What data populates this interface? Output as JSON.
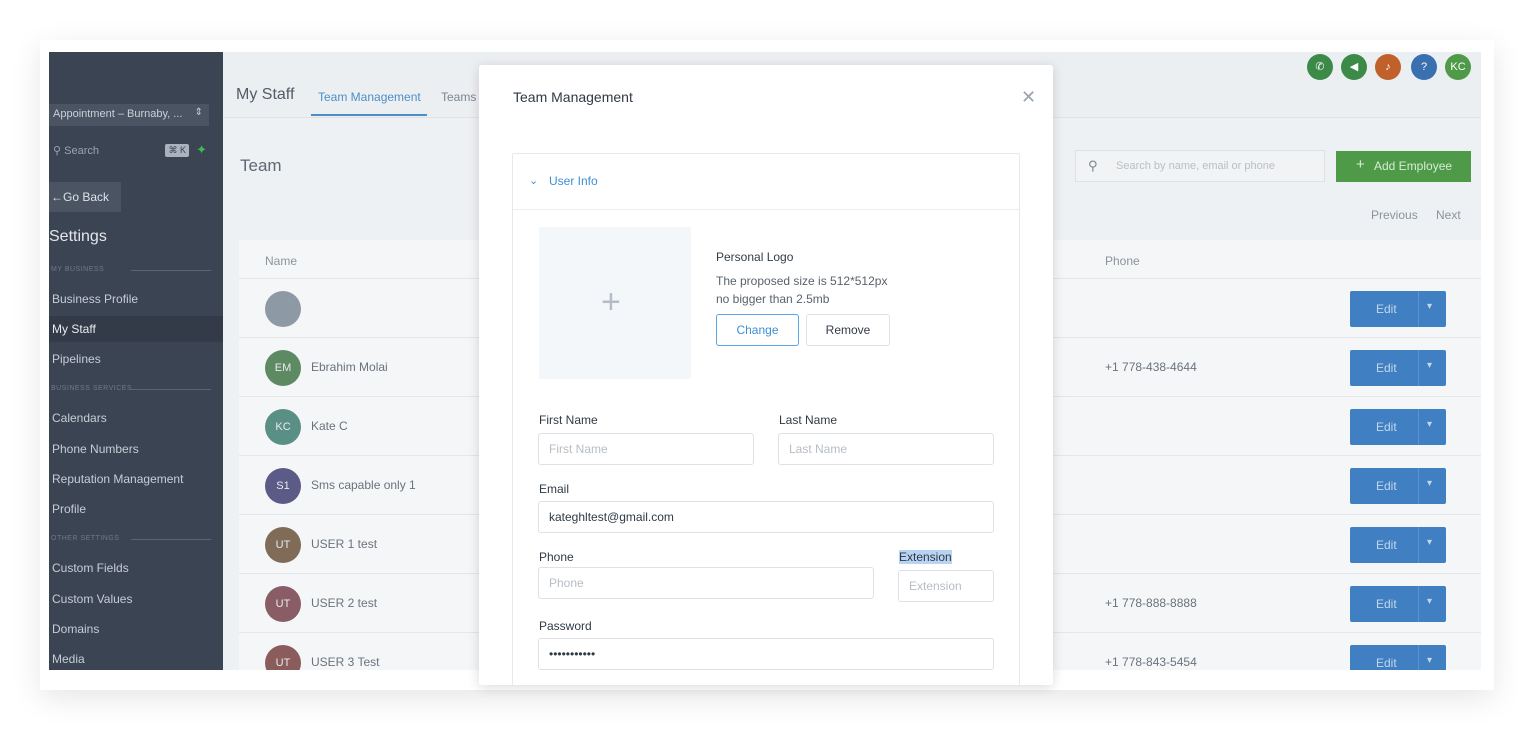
{
  "sidebar": {
    "location_select": "Appointment – Burnaby, ...",
    "search_placeholder": "Search",
    "search_shortcut": "⌘ K",
    "go_back": "Go Back",
    "settings_title": "Settings",
    "sections": [
      "MY BUSINESS",
      "BUSINESS SERVICES",
      "OTHER SETTINGS"
    ],
    "items": [
      {
        "label": "Business Profile",
        "active": false
      },
      {
        "label": "My Staff",
        "active": true
      },
      {
        "label": "Pipelines",
        "active": false
      },
      {
        "label": "Calendars",
        "active": false
      },
      {
        "label": "Phone Numbers",
        "active": false
      },
      {
        "label": "Reputation Management",
        "active": false
      },
      {
        "label": "Profile",
        "active": false
      },
      {
        "label": "Custom Fields",
        "active": false
      },
      {
        "label": "Custom Values",
        "active": false
      },
      {
        "label": "Domains",
        "active": false
      },
      {
        "label": "Media",
        "active": false
      }
    ]
  },
  "topbar": {
    "title": "My Staff",
    "tabs": [
      "Team Management",
      "Teams"
    ],
    "active_tab": "Team Management",
    "user_initials": "KC"
  },
  "main": {
    "title": "Team",
    "search_placeholder": "Search by name, email or phone",
    "add_button": "Add Employee",
    "pager": {
      "previous": "Previous",
      "next": "Next"
    },
    "columns": {
      "name": "Name",
      "phone": "Phone"
    },
    "rows": [
      {
        "initials": "",
        "name": "",
        "phone": "",
        "action": "Edit"
      },
      {
        "initials": "EM",
        "name": "Ebrahim Molai",
        "phone": "+1 778-438-4644",
        "action": "Edit"
      },
      {
        "initials": "KC",
        "name": "Kate C",
        "phone": "",
        "action": "Edit"
      },
      {
        "initials": "S1",
        "name": "Sms capable only 1",
        "phone": "",
        "action": "Edit"
      },
      {
        "initials": "UT",
        "name": "USER 1 test",
        "phone": "",
        "action": "Edit"
      },
      {
        "initials": "UT",
        "name": "USER 2 test",
        "phone": "+1 778-888-8888",
        "action": "Edit"
      },
      {
        "initials": "UT",
        "name": "USER 3 Test",
        "phone": "+1 778-843-5454",
        "action": "Edit"
      }
    ]
  },
  "modal": {
    "title": "Team Management",
    "section": "User Info",
    "logo": {
      "title": "Personal Logo",
      "size_hint": "The proposed size is 512*512px",
      "limit_hint": "no bigger than 2.5mb",
      "change": "Change",
      "remove": "Remove"
    },
    "fields": {
      "first_name": {
        "label": "First Name",
        "placeholder": "First Name",
        "value": ""
      },
      "last_name": {
        "label": "Last Name",
        "placeholder": "Last Name",
        "value": ""
      },
      "email": {
        "label": "Email",
        "value": "kateghltest@gmail.com"
      },
      "phone": {
        "label": "Phone",
        "placeholder": "Phone",
        "value": ""
      },
      "extension": {
        "label": "Extension",
        "placeholder": "Extension",
        "value": ""
      },
      "password": {
        "label": "Password",
        "value": "•••••••••••"
      }
    }
  },
  "colors": {
    "accent": "#3d8fd6",
    "sidebar": "#3b4453",
    "edit_button": "#3f7fc2",
    "add_button": "#4e9a48"
  }
}
